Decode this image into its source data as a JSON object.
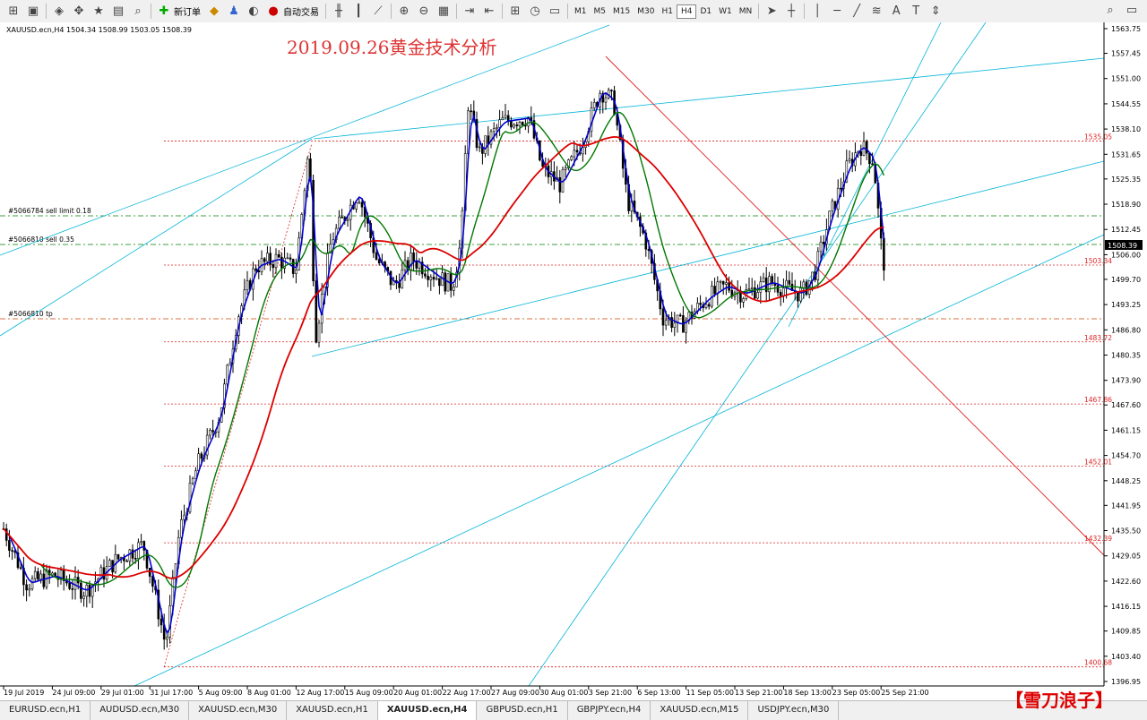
{
  "toolbar": {
    "new_order": "新订单",
    "auto_trade": "自动交易",
    "timeframes": [
      "M1",
      "M5",
      "M15",
      "M30",
      "H1",
      "H4",
      "D1",
      "W1",
      "MN"
    ],
    "active_timeframe": "H4"
  },
  "chart": {
    "header": "XAUUSD.ecn,H4  1504.34 1508.99 1503.05 1508.39",
    "annotation": "2019.09.26黄金技术分析",
    "current_price": "1508.39",
    "price_labels": [
      "1563.75",
      "1557.45",
      "1551.00",
      "1544.55",
      "1538.10",
      "1531.65",
      "1525.35",
      "1518.90",
      "1512.45",
      "1506.00",
      "1499.70",
      "1493.25",
      "1486.80",
      "1480.35",
      "1473.90",
      "1467.60",
      "1461.15",
      "1454.70",
      "1448.25",
      "1441.95",
      "1435.50",
      "1429.05",
      "1422.60",
      "1416.15",
      "1409.85",
      "1403.40",
      "1396.95"
    ],
    "time_labels": [
      "19 Jul 2019",
      "24 Jul 09:00",
      "29 Jul 01:00",
      "31 Jul 17:00",
      "5 Aug 09:00",
      "8 Aug 01:00",
      "12 Aug 17:00",
      "15 Aug 09:00",
      "20 Aug 01:00",
      "22 Aug 17:00",
      "27 Aug 09:00",
      "30 Aug 01:00",
      "3 Sep 21:00",
      "6 Sep 13:00",
      "11 Sep 05:00",
      "13 Sep 21:00",
      "18 Sep 13:00",
      "23 Sep 05:00",
      "25 Sep 21:00"
    ],
    "level_labels": [
      "1535.05",
      "1503.34",
      "1483.72",
      "1467.86",
      "1452.01",
      "1432.39",
      "1400.68"
    ],
    "order_labels": [
      "#5066784 sell limit 0.18",
      "#5066810 sell 0.35",
      "#5066810 tp"
    ],
    "colors": {
      "candle": "#000000",
      "ma_fast": "#0000cc",
      "ma_mid": "#007700",
      "ma_slow": "#dd0000",
      "trend": "#00b4d8",
      "level": "#dd2222",
      "order_green": "#008000"
    }
  },
  "tabs": [
    "EURUSD.ecn,H1",
    "AUDUSD.ecn,M30",
    "XAUUSD.ecn,M30",
    "XAUUSD.ecn,H1",
    "XAUUSD.ecn,H4",
    "GBPUSD.ecn,H1",
    "GBPJPY.ecn,H4",
    "XAUUSD.ecn,M15",
    "USDJPY.ecn,M30"
  ],
  "active_tab": "XAUUSD.ecn,H4",
  "watermark": "【雪刀浪子】"
}
